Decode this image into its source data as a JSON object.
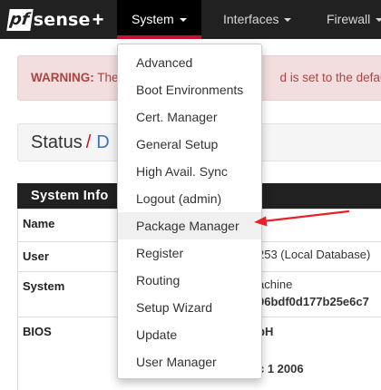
{
  "brand": {
    "pf": "pf",
    "sense": "sense",
    "plus": "+"
  },
  "navbar": {
    "items": [
      {
        "label": "System",
        "active": true
      },
      {
        "label": "Interfaces"
      },
      {
        "label": "Firewall"
      }
    ]
  },
  "warning": {
    "prefix": "WARNING:",
    "text_before": "The",
    "text_after": "d is set to the default"
  },
  "breadcrumb": {
    "title": "Status",
    "separator": "/",
    "current": "D"
  },
  "panel": {
    "title": "System Info",
    "rows": [
      {
        "label": "Name",
        "values": []
      },
      {
        "label": "User",
        "values": [
          "253 (Local Database)"
        ]
      },
      {
        "label": "System",
        "values": [
          "achine",
          "96bdf0d177b25e6c7"
        ]
      },
      {
        "label": "BIOS",
        "values": [
          "bH",
          "c 1 2006"
        ]
      }
    ]
  },
  "dropdown": {
    "items": [
      "Advanced",
      "Boot Environments",
      "Cert. Manager",
      "General Setup",
      "High Avail. Sync",
      "Logout (admin)",
      "Package Manager",
      "Register",
      "Routing",
      "Setup Wizard",
      "Update",
      "User Manager"
    ],
    "highlighted_index": 6
  },
  "annotation": {
    "arrow_color": "#e8202a"
  },
  "colors": {
    "navbar": "#212121",
    "accent": "#c8102e",
    "warning_bg": "#f2dede",
    "warning_text": "#a94442"
  }
}
